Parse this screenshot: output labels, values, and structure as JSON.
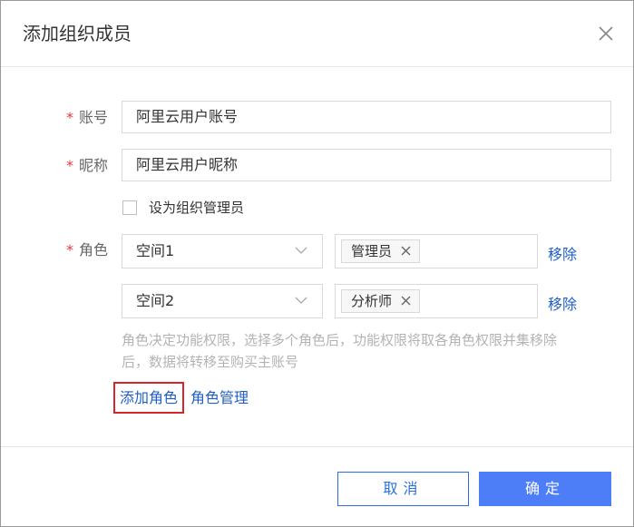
{
  "dialog": {
    "title": "添加组织成员",
    "close_icon": "close-icon"
  },
  "form": {
    "required_mark": "*",
    "account": {
      "label": "账号",
      "value": "阿里云用户账号"
    },
    "nickname": {
      "label": "昵称",
      "value": "阿里云用户昵称"
    },
    "admin_checkbox": {
      "label": "设为组织管理员",
      "checked": false
    },
    "role": {
      "label": "角色",
      "rows": [
        {
          "space": "空间1",
          "tag": "管理员",
          "remove": "移除"
        },
        {
          "space": "空间2",
          "tag": "分析师",
          "remove": "移除"
        }
      ],
      "hint": "角色决定功能权限，选择多个角色后，功能权限将取各角色权限并集移除后，数据将转移至购买主账号",
      "add_role": "添加角色",
      "manage_role": "角色管理"
    }
  },
  "footer": {
    "cancel": "取消",
    "confirm": "确定"
  },
  "colors": {
    "primary": "#4d7ef7",
    "link": "#1f5fc4",
    "required": "#e4393c",
    "highlight_border": "#d6252b"
  }
}
